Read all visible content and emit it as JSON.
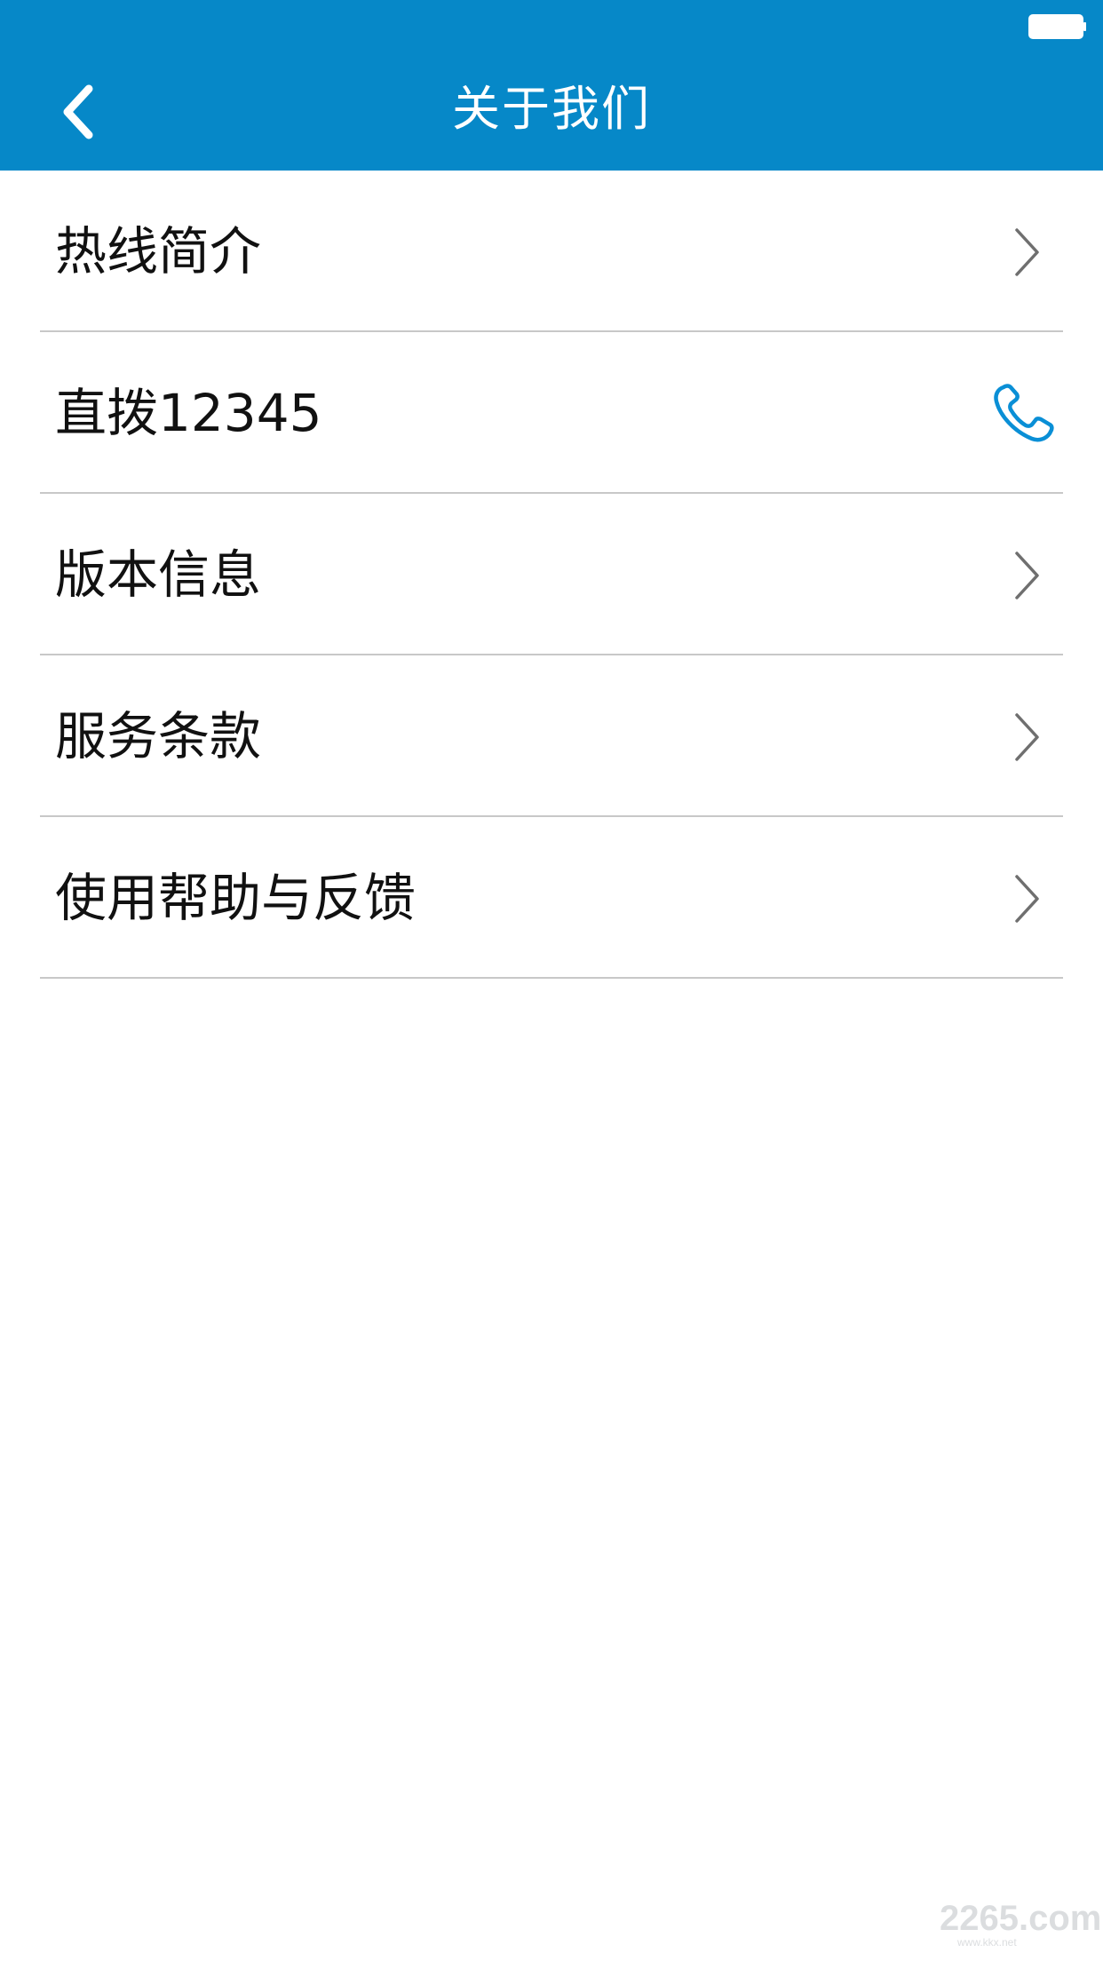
{
  "status_bar": {
    "battery_icon": "battery-icon"
  },
  "header": {
    "back_icon": "chevron-left-icon",
    "title": "关于我们",
    "background_color": "#0688c8"
  },
  "menu": {
    "items": [
      {
        "label": "热线简介",
        "icon": "chevron-right-icon"
      },
      {
        "label": "直拨12345",
        "icon": "phone-icon"
      },
      {
        "label": "版本信息",
        "icon": "chevron-right-icon"
      },
      {
        "label": "服务条款",
        "icon": "chevron-right-icon"
      },
      {
        "label": "使用帮助与反馈",
        "icon": "chevron-right-icon"
      }
    ],
    "phone_icon_color": "#0a8fd6"
  },
  "watermark": {
    "main": "2265.com",
    "sub": "www.kkx.net"
  }
}
